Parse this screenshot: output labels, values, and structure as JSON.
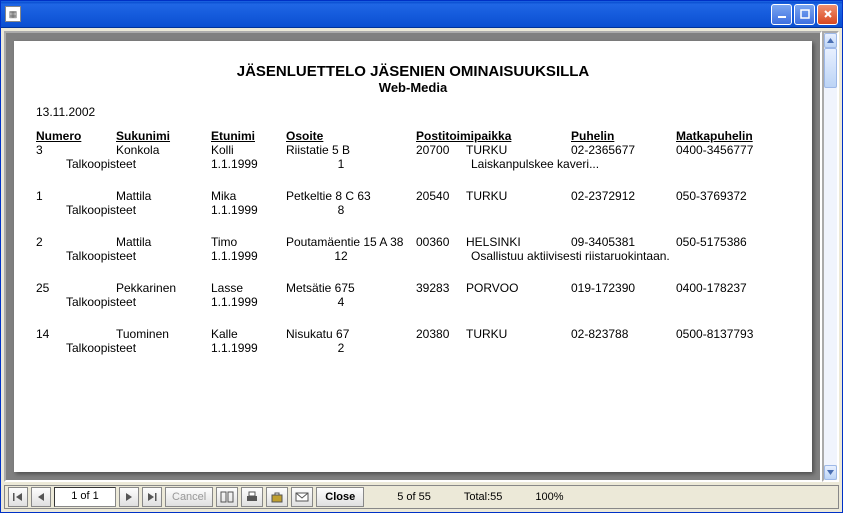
{
  "window": {
    "title": ""
  },
  "report": {
    "title": "JÄSENLUETTELO JÄSENIEN OMINAISUUKSILLA",
    "subtitle": "Web-Media",
    "date": "13.11.2002",
    "headers": {
      "numero": "Numero",
      "sukunimi": "Sukunimi",
      "etunimi": "Etunimi",
      "osoite": "Osoite",
      "postitoimipaikka": "Postitoimipaikka",
      "puhelin": "Puhelin",
      "matkapuhelin": "Matkapuhelin"
    },
    "labels": {
      "talkoopisteet": "Talkoopisteet"
    },
    "rows": [
      {
        "num": "3",
        "suku": "Konkola",
        "etu": "Kolli",
        "osoite": "Riistatie 5 B",
        "zip": "20700",
        "city": "TURKU",
        "puh": "02-2365677",
        "matka": "0400-3456777",
        "tdate": "1.1.1999",
        "tval": "1",
        "note": "Laiskanpulskee kaveri..."
      },
      {
        "num": "1",
        "suku": "Mattila",
        "etu": "Mika",
        "osoite": "Petkeltie 8 C 63",
        "zip": "20540",
        "city": "TURKU",
        "puh": "02-2372912",
        "matka": "050-3769372",
        "tdate": "1.1.1999",
        "tval": "8",
        "note": ""
      },
      {
        "num": "2",
        "suku": "Mattila",
        "etu": "Timo",
        "osoite": "Poutamäentie 15 A 38",
        "zip": "00360",
        "city": "HELSINKI",
        "puh": "09-3405381",
        "matka": "050-5175386",
        "tdate": "1.1.1999",
        "tval": "12",
        "note": "Osallistuu aktiivisesti riistaruokintaan."
      },
      {
        "num": "25",
        "suku": "Pekkarinen",
        "etu": "Lasse",
        "osoite": "Metsätie 675",
        "zip": "39283",
        "city": "PORVOO",
        "puh": "019-172390",
        "matka": "0400-178237",
        "tdate": "1.1.1999",
        "tval": "4",
        "note": ""
      },
      {
        "num": "14",
        "suku": "Tuominen",
        "etu": "Kalle",
        "osoite": "Nisukatu 67",
        "zip": "20380",
        "city": "TURKU",
        "puh": "02-823788",
        "matka": "0500-8137793",
        "tdate": "1.1.1999",
        "tval": "2",
        "note": ""
      }
    ]
  },
  "toolbar": {
    "page_display": "1 of 1",
    "cancel": "Cancel",
    "close": "Close",
    "record_pos": "5 of 55",
    "total": "Total:55",
    "zoom": "100%"
  }
}
